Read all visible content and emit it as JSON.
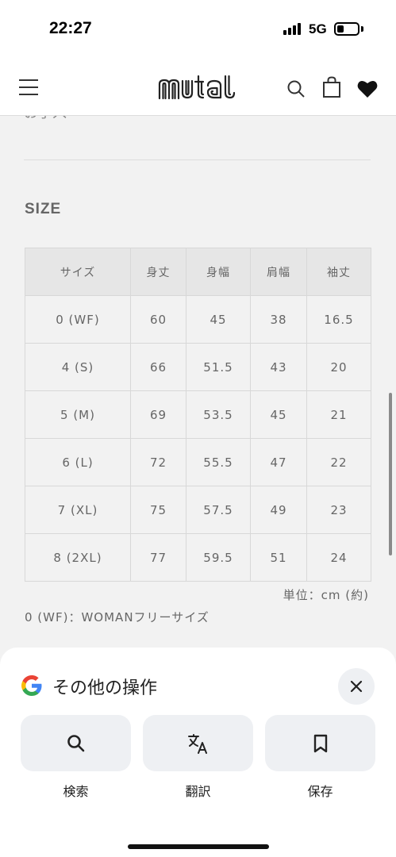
{
  "status": {
    "time": "22:27",
    "network": "5G"
  },
  "header": {
    "logo_text": "muta"
  },
  "section": {
    "cut_text": "お手入",
    "heading": "SIZE",
    "columns": [
      "サイズ",
      "身丈",
      "身幅",
      "肩幅",
      "袖丈"
    ],
    "rows": [
      [
        "0 (WF)",
        "60",
        "45",
        "38",
        "16.5"
      ],
      [
        "4 (S)",
        "66",
        "51.5",
        "43",
        "20"
      ],
      [
        "5 (M)",
        "69",
        "53.5",
        "45",
        "21"
      ],
      [
        "6 (L)",
        "72",
        "55.5",
        "47",
        "22"
      ],
      [
        "7 (XL)",
        "75",
        "57.5",
        "49",
        "23"
      ],
      [
        "8 (2XL)",
        "77",
        "59.5",
        "51",
        "24"
      ]
    ],
    "unit_note": "単位：cm (約)",
    "wf_note": "0 (WF)：WOMANフリーサイズ"
  },
  "sheet": {
    "title": "その他の操作",
    "actions": [
      {
        "label": "検索",
        "icon": "search-icon"
      },
      {
        "label": "翻訳",
        "icon": "translate-icon"
      },
      {
        "label": "保存",
        "icon": "bookmark-icon"
      }
    ]
  }
}
